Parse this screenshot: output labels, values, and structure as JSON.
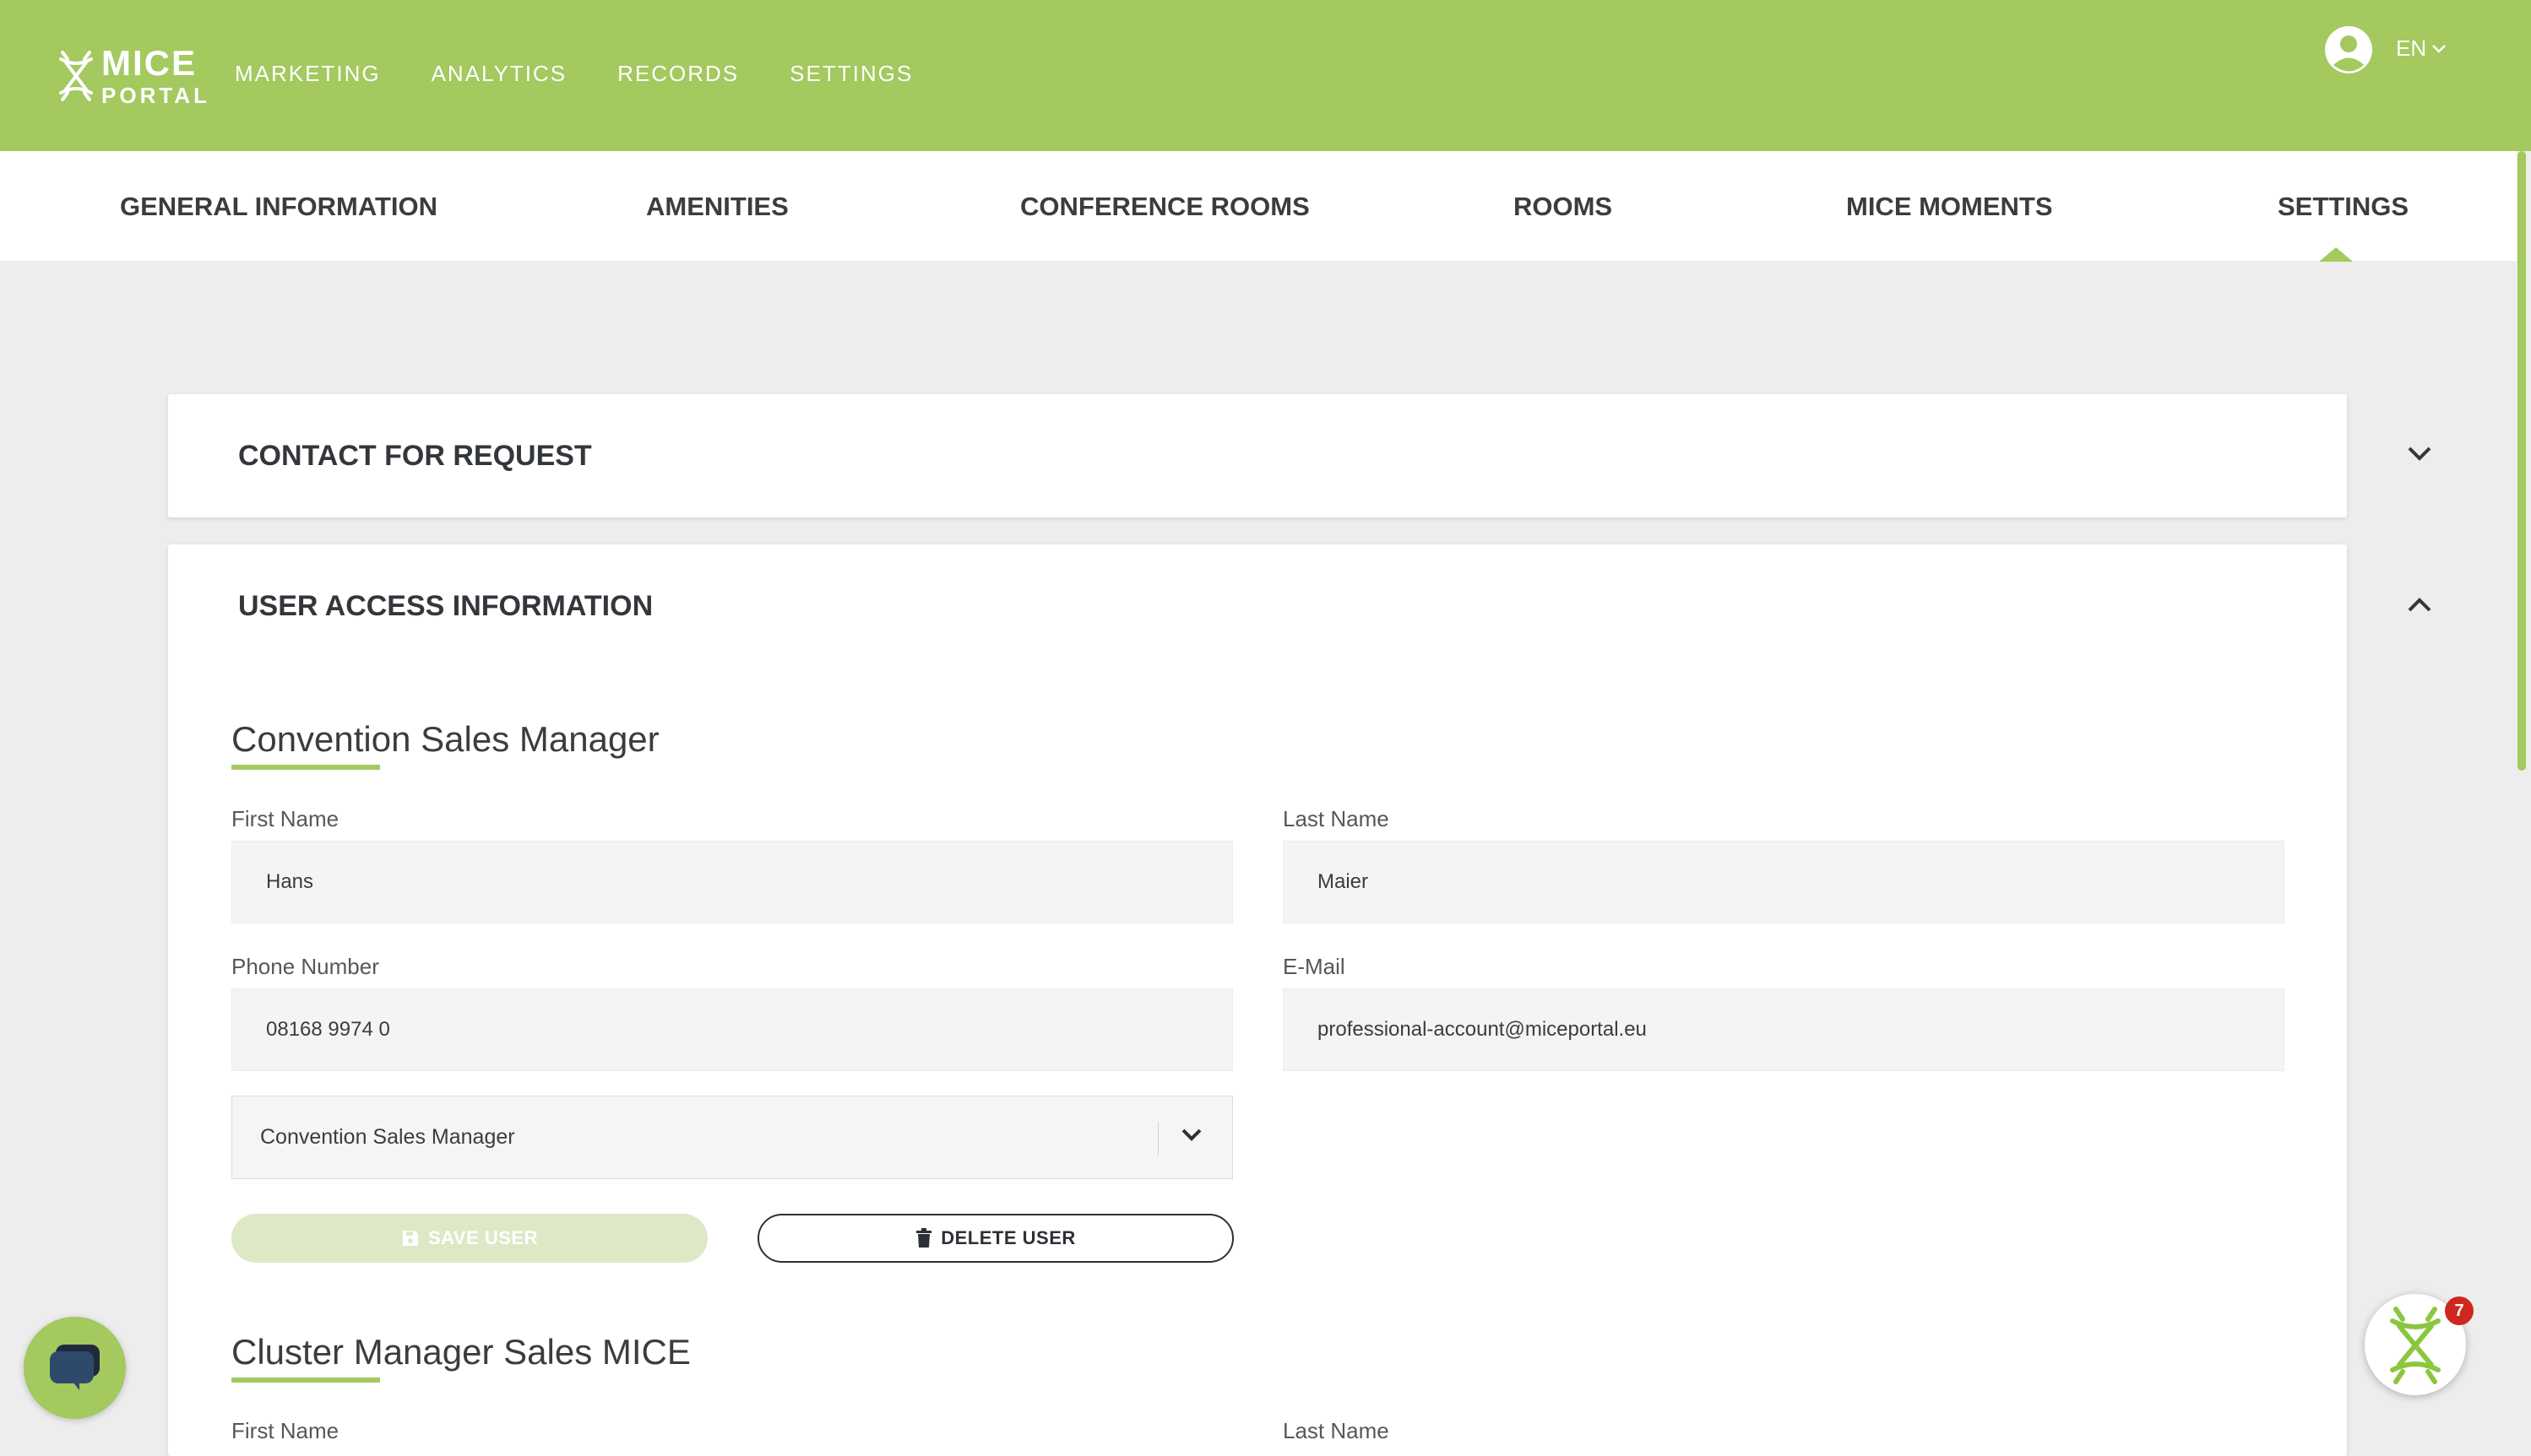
{
  "brand": {
    "line1": "MICE",
    "line2": "PORTAL",
    "accent": "#a3c95f"
  },
  "topnav": {
    "marketing": "MARKETING",
    "analytics": "ANALYTICS",
    "records": "RECORDS",
    "settings": "SETTINGS"
  },
  "header": {
    "language": "EN",
    "user_icon": "account-circle-icon"
  },
  "tabs": {
    "general": "GENERAL INFORMATION",
    "amenities": "AMENITIES",
    "conference": "CONFERENCE ROOMS",
    "rooms": "ROOMS",
    "moments": "MICE MOMENTS",
    "settings": "SETTINGS",
    "active": "SETTINGS"
  },
  "contact_card": {
    "title": "CONTACT FOR REQUEST",
    "expanded": false
  },
  "access_card": {
    "title": "USER ACCESS INFORMATION",
    "expanded": true,
    "user1": {
      "section_title": "Convention Sales Manager",
      "first_name_label": "First Name",
      "first_name": "Hans",
      "last_name_label": "Last Name",
      "last_name": "Maier",
      "phone_label": "Phone Number",
      "phone": "08168 9974 0",
      "email_label": "E-Mail",
      "email": "professional-account@miceportal.eu",
      "role": "Convention Sales Manager",
      "save_label": "SAVE USER",
      "delete_label": "DELETE USER"
    },
    "user2": {
      "section_title": "Cluster Manager Sales MICE",
      "first_name_label": "First Name",
      "last_name_label": "Last Name"
    }
  },
  "floating": {
    "notification_count": "7"
  }
}
